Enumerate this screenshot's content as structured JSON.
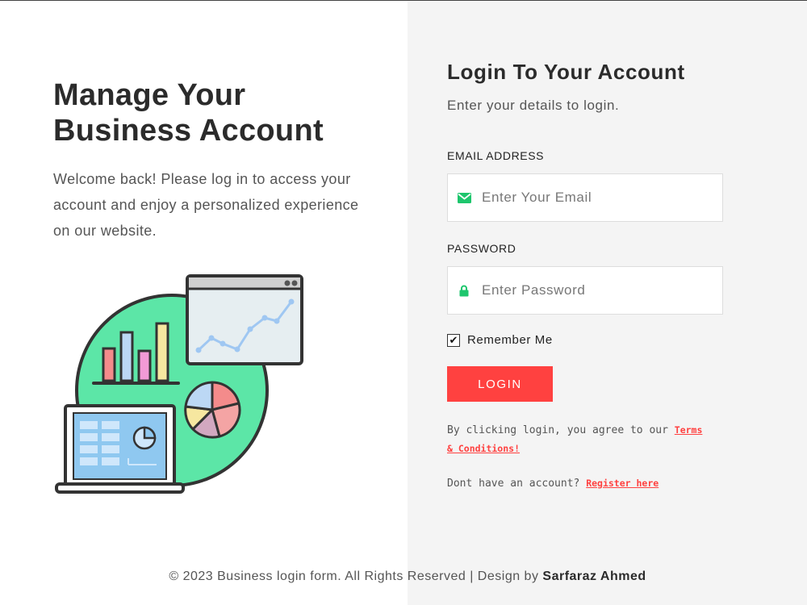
{
  "hero": {
    "title_line1": "Manage Your",
    "title_line2": "Business Account",
    "text": "Welcome back! Please log in to access your account and enjoy a personalized experience on our website."
  },
  "login": {
    "title": "Login To Your Account",
    "subtitle": "Enter your details to login.",
    "email_label": "EMAIL ADDRESS",
    "email_placeholder": "Enter Your Email",
    "email_value": "",
    "password_label": "PASSWORD",
    "password_placeholder": "Enter Password",
    "password_value": "",
    "remember_label": "Remember Me",
    "remember_checked": true,
    "button_label": "LOGIN",
    "terms_prefix": "By clicking login, you agree to our ",
    "terms_link": "Terms & Conditions!",
    "register_prefix": "Dont have an account? ",
    "register_link": "Register here"
  },
  "footer": {
    "text": "© 2023 Business login form. All Rights Reserved | Design by ",
    "author": "Sarfaraz Ahmed"
  },
  "icons": {
    "email": "envelope-icon",
    "password": "lock-icon",
    "check": "checkmark-icon"
  },
  "colors": {
    "accent": "#ff4140",
    "icon_green": "#1ec66d",
    "illustration_green": "#5ce6a7",
    "right_panel_bg": "#f4f4f4"
  }
}
